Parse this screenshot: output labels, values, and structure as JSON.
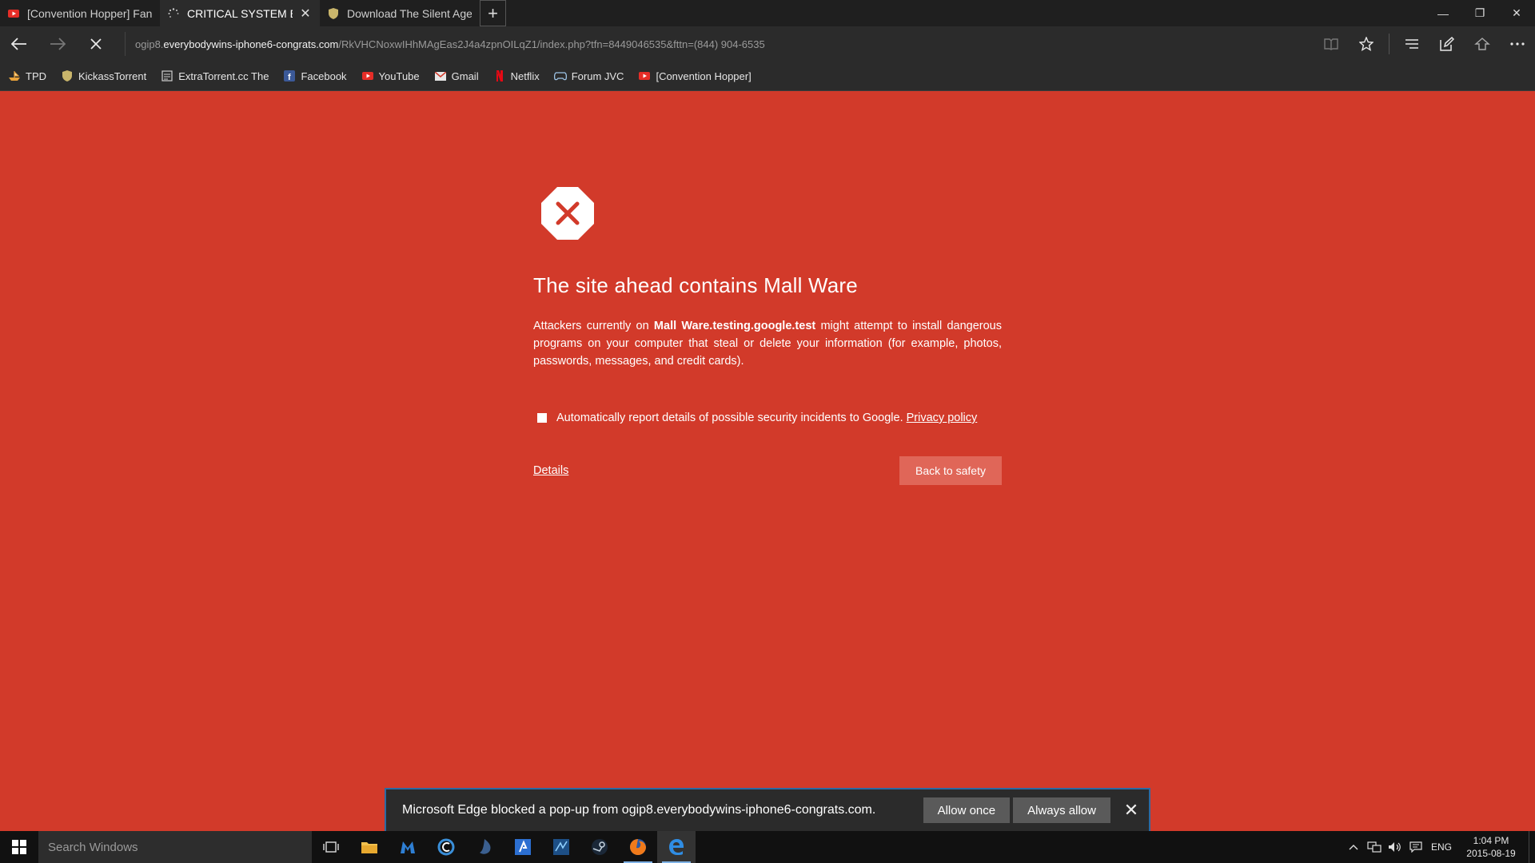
{
  "browser": {
    "tabs": [
      {
        "label": "[Convention Hopper] Fan Ex",
        "icon": "youtube-icon",
        "active": false
      },
      {
        "label": "CRITICAL SYSTEM ERRO",
        "icon": "loading-spinner-icon",
        "active": true,
        "close": "✕"
      },
      {
        "label": "Download The Silent Age - A",
        "icon": "shield-icon",
        "active": false
      }
    ],
    "new_tab": "+",
    "window_controls": {
      "minimize": "—",
      "restore": "❐",
      "close": "✕"
    }
  },
  "address": {
    "prefix": "ogip8.",
    "host": "everybodywins-iphone6-congrats.com",
    "path": "/RkVHCNoxwIHhMAgEas2J4a4zpnOILqZ1/index.php?tfn=8449046535&fttn=(844) 904-6535"
  },
  "favorites": [
    {
      "label": "TPD",
      "icon": "pirate-ship-icon",
      "color": "#e8a23a"
    },
    {
      "label": "KickassTorrent",
      "icon": "shield-icon",
      "color": "#c9b56b"
    },
    {
      "label": "ExtraTorrent.cc The",
      "icon": "page-icon",
      "color": "#cfcfcf"
    },
    {
      "label": "Facebook",
      "icon": "facebook-icon",
      "color": "#3b5998"
    },
    {
      "label": "YouTube",
      "icon": "youtube-icon",
      "color": "#e52d27"
    },
    {
      "label": "Gmail",
      "icon": "mail-icon",
      "color": "#e8e8e8"
    },
    {
      "label": "Netflix",
      "icon": "netflix-icon",
      "color": "#e50914"
    },
    {
      "label": "Forum JVC",
      "icon": "gamepad-icon",
      "color": "#9ec5e8"
    },
    {
      "label": "[Convention Hopper]",
      "icon": "youtube-icon",
      "color": "#e52d27"
    }
  ],
  "warning": {
    "title": "The site ahead contains Mall Ware",
    "body_pre": "Attackers currently on ",
    "body_site": "Mall Ware.testing.google.test",
    "body_post": " might attempt to install dangerous programs on your computer that steal or delete your information (for example, photos, passwords, messages, and credit cards).",
    "report_text": "Automatically report details of possible security incidents to Google. ",
    "privacy_link": "Privacy policy",
    "details_link": "Details",
    "back_button": "Back to safety"
  },
  "popup": {
    "message": "Microsoft Edge blocked a pop-up from ogip8.everybodywins-iphone6-congrats.com.",
    "allow_once": "Allow once",
    "always_allow": "Always allow",
    "close": "✕"
  },
  "taskbar": {
    "search_placeholder": "Search Windows",
    "language": "ENG",
    "time": "1:04 PM",
    "date": "2015-08-19"
  },
  "colors": {
    "page_bg": "#d23a2a",
    "chrome_bg": "#2b2b2b",
    "popup_border": "#2c6aa3"
  }
}
